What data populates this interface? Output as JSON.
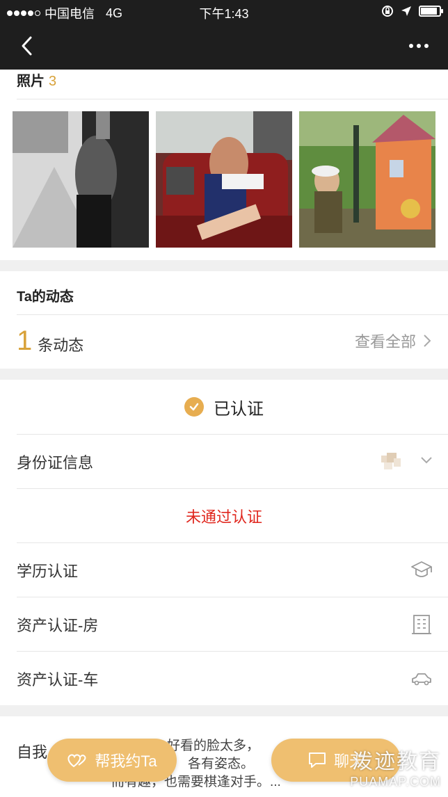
{
  "status_bar": {
    "carrier": "中国电信",
    "network": "4G",
    "time": "下午1:43",
    "signal_bars_filled": 4,
    "signal_bars_total": 5,
    "battery_level": 0.9
  },
  "nav": {
    "back_icon": "chevron-left-icon",
    "more_icon": "more-dots-icon"
  },
  "photos": {
    "title": "照片",
    "count": "3",
    "items": [
      "photo-1",
      "photo-2",
      "photo-3"
    ]
  },
  "dynamics": {
    "title": "Ta的动态",
    "count": "1",
    "count_label": "条动态",
    "view_all": "查看全部"
  },
  "verification": {
    "status": "已认证",
    "rows": [
      {
        "label": "身份证信息",
        "icon": "chevron-down-icon"
      },
      {
        "label": "未通过认证"
      },
      {
        "label": "学历认证",
        "icon": "graduation-cap-icon"
      },
      {
        "label": "资产认证-房",
        "icon": "building-icon"
      },
      {
        "label": "资产认证-车",
        "icon": "car-icon"
      }
    ]
  },
  "bio": {
    "label": "自我",
    "text_line1": "好看的脸太多，",
    "text_line2": "各有姿态。",
    "text_line3": "而有趣，也需要棋逢对手。..."
  },
  "actions": {
    "left": "帮我约Ta",
    "right": "聊天"
  },
  "watermark": {
    "big": "泼迹教育",
    "small": "PUAMAP.COM"
  },
  "colors": {
    "accent": "#d8a23a",
    "button": "#efbf70",
    "error": "#e0271e",
    "bar_bg": "#1e1e1e"
  }
}
